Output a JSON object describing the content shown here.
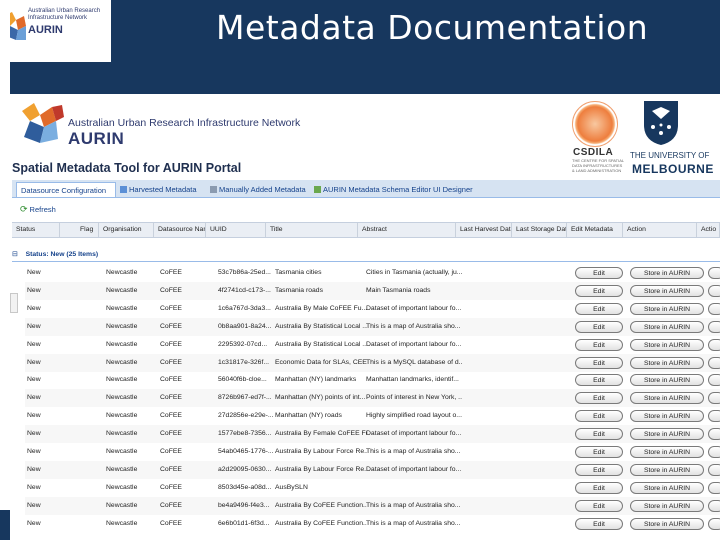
{
  "slide": {
    "title": "Metadata Documentation",
    "logo_small_text": "Australian Urban Research Infrastructure Network",
    "logo_small_name": "AURIN"
  },
  "banner": {
    "org_full_name": "Australian Urban Research Infrastructure Network",
    "org_short": "AURIN",
    "csdila_name": "CSDILA",
    "csdila_sub": "THE CENTRE FOR SPATIAL DATA INFRASTRUCTURES & LAND ADMINISTRATION",
    "university_line1": "THE UNIVERSITY OF",
    "university_line2": "MELBOURNE"
  },
  "app": {
    "title": "Spatial Metadata Tool for AURIN Portal",
    "tabs": [
      {
        "label": "Datasource Configuration",
        "active": true
      },
      {
        "label": "Harvested Metadata",
        "active": false
      },
      {
        "label": "Manually Added Metadata",
        "active": false
      },
      {
        "label": "AURIN Metadata Schema Editor UI Designer",
        "active": false
      }
    ],
    "toolbar": {
      "refresh_label": "Refresh"
    },
    "columns": [
      "Status",
      "Flag",
      "Organisation",
      "Datasource Name",
      "UUID",
      "Title",
      "Abstract",
      "Last Harvest Date/",
      "Last Storage Date/",
      "Edit Metadata",
      "Action",
      "Actio"
    ],
    "group_label": "Status: New (25 Items)",
    "edit_label": "Edit",
    "store_label": "Store in AURIN",
    "rows": [
      {
        "status": "New",
        "org": "Newcastle",
        "ds": "CoFEE",
        "uuid": "53c7b86a-25ed...",
        "title": "Tasmania cities",
        "abstract": "Cities in Tasmania (actually, ju..."
      },
      {
        "status": "New",
        "org": "Newcastle",
        "ds": "CoFEE",
        "uuid": "4f2741cd-c173-...",
        "title": "Tasmania roads",
        "abstract": "Main Tasmania roads"
      },
      {
        "status": "New",
        "org": "Newcastle",
        "ds": "CoFEE",
        "uuid": "1c6a767d-3da3...",
        "title": "Australia By Male CoFEE Fu...",
        "abstract": "Dataset of important labour fo..."
      },
      {
        "status": "New",
        "org": "Newcastle",
        "ds": "CoFEE",
        "uuid": "0b8aa901-8a24...",
        "title": "Australia By Statistical Local ...",
        "abstract": "This is a map of Australia sho..."
      },
      {
        "status": "New",
        "org": "Newcastle",
        "ds": "CoFEE",
        "uuid": "2295392-07cd...",
        "title": "Australia By Statistical Local ...",
        "abstract": "Dataset of important labour fo..."
      },
      {
        "status": "New",
        "org": "Newcastle",
        "ds": "CoFEE",
        "uuid": "1c31817e-326f...",
        "title": "Economic Data for SLAs, CEE...",
        "abstract": "This is a MySQL database of d..."
      },
      {
        "status": "New",
        "org": "Newcastle",
        "ds": "CoFEE",
        "uuid": "56040f6b-cloe...",
        "title": "Manhattan (NY) landmarks",
        "abstract": "Manhattan landmarks, identif..."
      },
      {
        "status": "New",
        "org": "Newcastle",
        "ds": "CoFEE",
        "uuid": "8726b967-ed7f-...",
        "title": "Manhattan (NY) points of int...",
        "abstract": "Points of interest in New York, ..."
      },
      {
        "status": "New",
        "org": "Newcastle",
        "ds": "CoFEE",
        "uuid": "27d2856e-e29e-...",
        "title": "Manhattan (NY) roads",
        "abstract": "Highly simplified road layout o..."
      },
      {
        "status": "New",
        "org": "Newcastle",
        "ds": "CoFEE",
        "uuid": "1577ebe8-7356...",
        "title": "Australia By Female CoFEE Fu...",
        "abstract": "Dataset of important labour fo..."
      },
      {
        "status": "New",
        "org": "Newcastle",
        "ds": "CoFEE",
        "uuid": "54ab0465-1776-...",
        "title": "Australia By Labour Force Re...",
        "abstract": "This is a map of Australia sho..."
      },
      {
        "status": "New",
        "org": "Newcastle",
        "ds": "CoFEE",
        "uuid": "a2d29095-0630...",
        "title": "Australia By Labour Force Re...",
        "abstract": "Dataset of important labour fo..."
      },
      {
        "status": "New",
        "org": "Newcastle",
        "ds": "CoFEE",
        "uuid": "8503d45e-a08d...",
        "title": "AusBySLN",
        "abstract": ""
      },
      {
        "status": "New",
        "org": "Newcastle",
        "ds": "CoFEE",
        "uuid": "be4a9496-f4e3...",
        "title": "Australia By CoFEE Function...",
        "abstract": "This is a map of Australia sho..."
      },
      {
        "status": "New",
        "org": "Newcastle",
        "ds": "CoFEE",
        "uuid": "6e6b01d1-6f3d...",
        "title": "Australia By CoFEE Function...",
        "abstract": "This is a map of Australia sho..."
      }
    ]
  }
}
